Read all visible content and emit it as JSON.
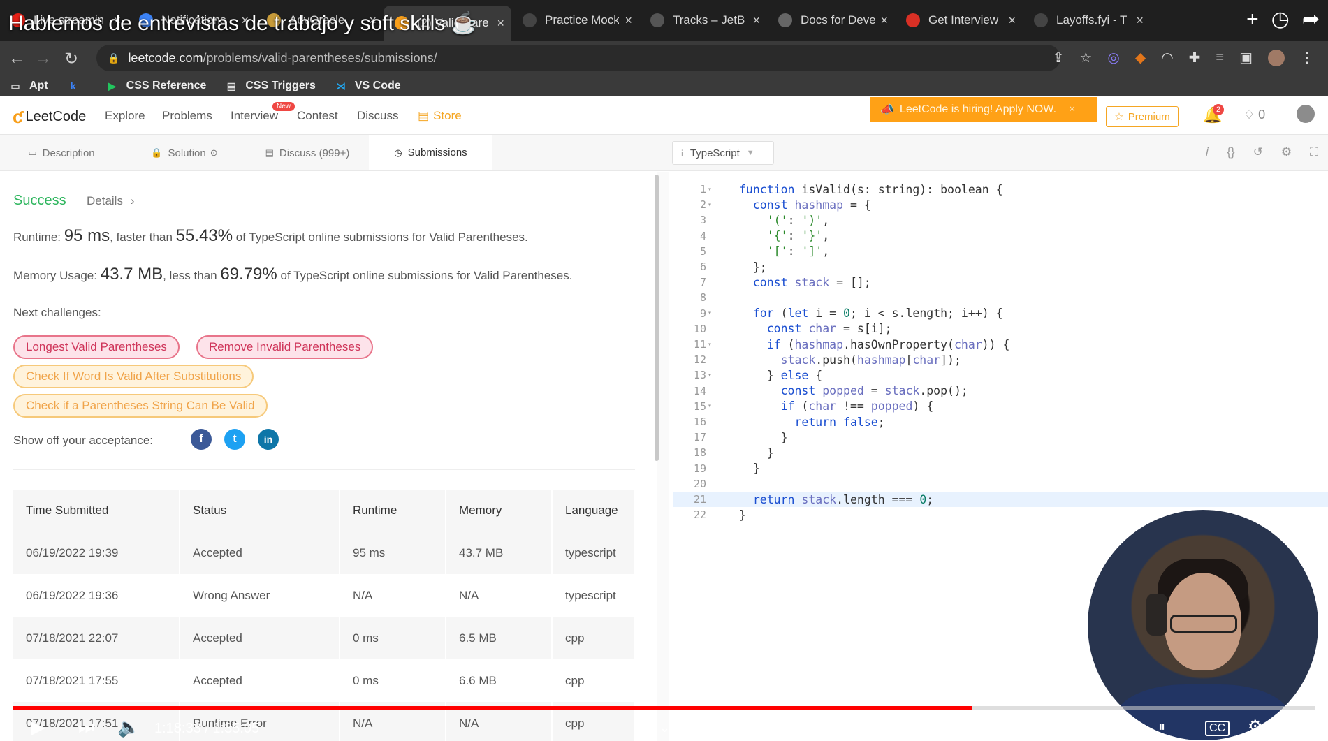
{
  "video": {
    "title": "Hablemos de entrevistas de trabajo y soft skills ☕",
    "time_current": "1:18:33",
    "time_total": "1:35:05",
    "time_display": "1:18:33 / 1:35:05",
    "progress_fraction": 0.7364
  },
  "browser": {
    "tabs": [
      {
        "label": "Live streamin",
        "icon": "youtube-icon",
        "color": "#e62117"
      },
      {
        "label": "Notifications",
        "icon": "bell-icon",
        "color": "#3b82f6"
      },
      {
        "label": "AdvOracle",
        "icon": "doc-icon",
        "color": "#c79b3a"
      },
      {
        "label": "(2) Valid Pare",
        "icon": "leetcode-icon",
        "color": "#f89f1b",
        "active": true
      },
      {
        "label": "Practice Mock",
        "icon": "check-icon",
        "color": "#444"
      },
      {
        "label": "Tracks – JetB",
        "icon": "jetbrains-icon",
        "color": "#555"
      },
      {
        "label": "Docs for Deve",
        "icon": "doc-icon",
        "color": "#666"
      },
      {
        "label": "Get Interview",
        "icon": "record-icon",
        "color": "#d93025"
      },
      {
        "label": "Layoffs.fyi - T",
        "icon": "l-icon",
        "color": "#444"
      }
    ],
    "url_host": "leetcode.com",
    "url_path": "/problems/valid-parentheses/submissions/",
    "bookmarks": [
      {
        "label": "Apt",
        "icon": "folder-icon"
      },
      {
        "label": "",
        "icon": "k-icon"
      },
      {
        "label": "CSS Reference",
        "icon": "css-reference-icon"
      },
      {
        "label": "CSS Triggers",
        "icon": "css-triggers-icon"
      },
      {
        "label": "VS Code",
        "icon": "vscode-icon"
      }
    ]
  },
  "nav": {
    "logo": "LeetCode",
    "links": [
      "Explore",
      "Problems",
      "Interview",
      "Contest",
      "Discuss",
      "Store"
    ],
    "new_badge": "New",
    "hiring": "LeetCode is hiring! Apply NOW.",
    "premium": "Premium",
    "notifications": "2",
    "streak": "0"
  },
  "panel_tabs": [
    "Description",
    "Solution",
    "Discuss (999+)",
    "Submissions"
  ],
  "editor": {
    "language": "TypeScript"
  },
  "result": {
    "status": "Success",
    "details": "Details",
    "runtime_label": "Runtime:",
    "runtime_value": "95 ms",
    "runtime_mid": ", faster than",
    "runtime_pct": "55.43%",
    "runtime_tail": "of TypeScript online submissions for Valid Parentheses.",
    "memory_label": "Memory Usage:",
    "memory_value": "43.7 MB",
    "memory_mid": ", less than",
    "memory_pct": "69.79%",
    "memory_tail": "of TypeScript online submissions for Valid Parentheses.",
    "next_label": "Next challenges:",
    "challenges": [
      "Longest Valid Parentheses",
      "Remove Invalid Parentheses",
      "Check If Word Is Valid After Substitutions",
      "Check if a Parentheses String Can Be Valid"
    ],
    "share_label": "Show off your acceptance:"
  },
  "submissions": {
    "headers": [
      "Time Submitted",
      "Status",
      "Runtime",
      "Memory",
      "Language"
    ],
    "rows": [
      [
        "06/19/2022 19:39",
        "Accepted",
        "95 ms",
        "43.7 MB",
        "typescript"
      ],
      [
        "06/19/2022 19:36",
        "Wrong Answer",
        "N/A",
        "N/A",
        "typescript"
      ],
      [
        "07/18/2021 22:07",
        "Accepted",
        "0 ms",
        "6.5 MB",
        "cpp"
      ],
      [
        "07/18/2021 17:55",
        "Accepted",
        "0 ms",
        "6.6 MB",
        "cpp"
      ],
      [
        "07/18/2021 17:51",
        "Runtime Error",
        "N/A",
        "N/A",
        "cpp"
      ]
    ]
  },
  "code_lines": [
    "function isValid(s: string): boolean {",
    "  const hashmap = {",
    "    '(': ')',",
    "    '{': '}',",
    "    '[': ']',",
    "  };",
    "  const stack = [];",
    "",
    "  for (let i = 0; i < s.length; i++) {",
    "    const char = s[i];",
    "    if (hashmap.hasOwnProperty(char)) {",
    "      stack.push(hashmap[char]);",
    "    } else {",
    "      const popped = stack.pop();",
    "      if (char !== popped) {",
    "        return false;",
    "      }",
    "    }",
    "  }",
    "",
    "  return stack.length === 0;",
    "}"
  ],
  "fold_lines": [
    1,
    2,
    9,
    11,
    13,
    15
  ],
  "highlight_line": 21
}
